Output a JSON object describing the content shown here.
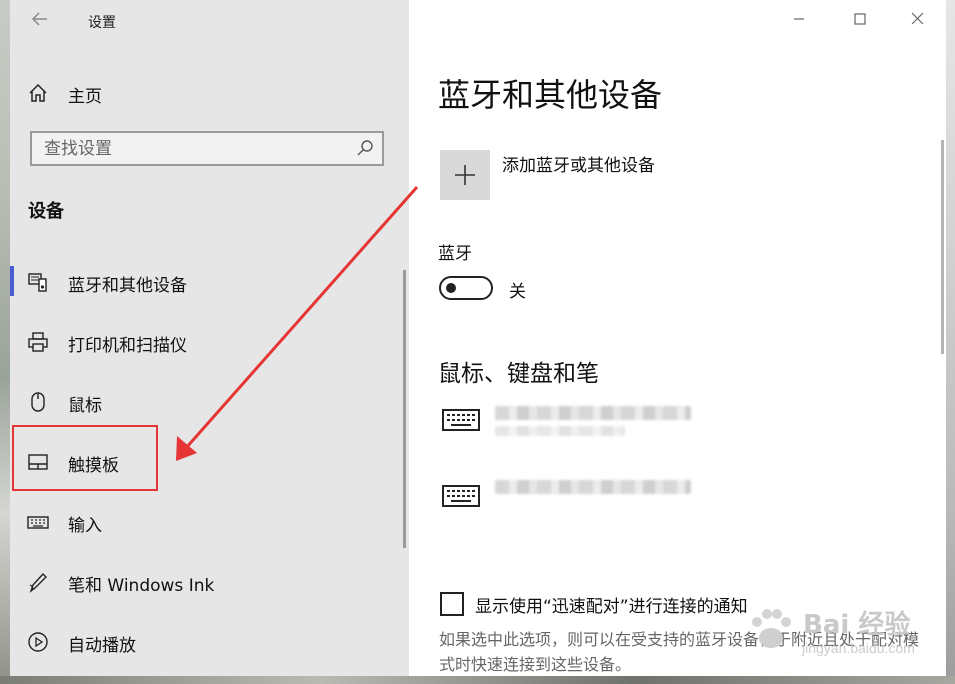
{
  "window": {
    "title": "设置"
  },
  "sidebar": {
    "home_label": "主页",
    "search_placeholder": "查找设置",
    "section_title": "设备",
    "items": [
      {
        "label": "蓝牙和其他设备",
        "icon": "bluetooth-devices-icon",
        "active": true
      },
      {
        "label": "打印机和扫描仪",
        "icon": "printer-icon"
      },
      {
        "label": "鼠标",
        "icon": "mouse-icon"
      },
      {
        "label": "触摸板",
        "icon": "touchpad-icon"
      },
      {
        "label": "输入",
        "icon": "keyboard-icon"
      },
      {
        "label": "笔和 Windows Ink",
        "icon": "pen-icon"
      },
      {
        "label": "自动播放",
        "icon": "autoplay-icon"
      }
    ]
  },
  "main": {
    "title": "蓝牙和其他设备",
    "add_device_label": "添加蓝牙或其他设备",
    "bluetooth_label": "蓝牙",
    "bluetooth_state": "关",
    "mouse_section_title": "鼠标、键盘和笔",
    "checkbox_label": "显示使用“迅速配对”进行连接的通知",
    "description": "如果选中此选项，则可以在受支持的蓝牙设备位于附近且处于配对模式时快速连接到这些设备。"
  },
  "watermark": {
    "text": "Bai 经验",
    "sub": "jingyan.baidu.com"
  },
  "colors": {
    "accent": "#4c5dd4",
    "annotation": "#e53535",
    "sidebar_bg": "#e6e6e6"
  }
}
